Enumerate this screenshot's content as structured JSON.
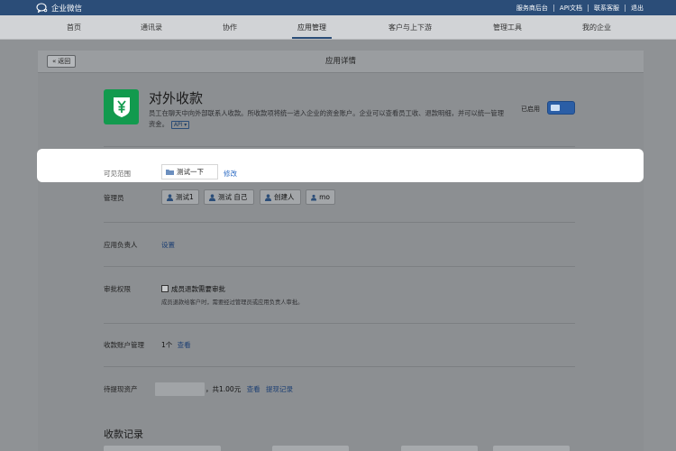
{
  "topbar": {
    "logo_text": "企业微信",
    "links": [
      "服务商后台",
      "API文档",
      "联系客服",
      "退出"
    ]
  },
  "nav": {
    "items": [
      "首页",
      "通讯录",
      "协作",
      "应用管理",
      "客户与上下游",
      "管理工具",
      "我的企业"
    ],
    "active_index": 3
  },
  "card": {
    "back_label": "返回",
    "title": "应用详情"
  },
  "app": {
    "icon": "yen-shield-icon",
    "icon_color": "#129a4e",
    "name": "对外收款",
    "description": "员工在聊天中向外部联系人收款。所收款项将统一进入企业的资金账户。企业可以查看员工收、退款明细，并可以统一管理资金。",
    "api_tag": "API",
    "status_label": "已启用",
    "enabled": true
  },
  "scope": {
    "label": "可见范围",
    "value": "测试一下",
    "edit_link": "修改"
  },
  "admins": {
    "label": "管理员",
    "items": [
      "测试1",
      "测试 自己",
      "创建人",
      "mo"
    ]
  },
  "owner": {
    "label": "应用负责人",
    "link": "设置"
  },
  "approval": {
    "label": "审批权限",
    "checkbox_label": "成员退款需要审批",
    "checked": false,
    "note": "成员退款给客户时，需要经过管理员或应用负责人审批。"
  },
  "accounts": {
    "label": "收款账户管理",
    "count": "1个",
    "view_link": "查看"
  },
  "withdraw": {
    "label": "待提现资产",
    "total": "，共1.00元",
    "view_link": "查看",
    "records_link": "提现记录"
  },
  "records": {
    "title": "收款记录"
  }
}
